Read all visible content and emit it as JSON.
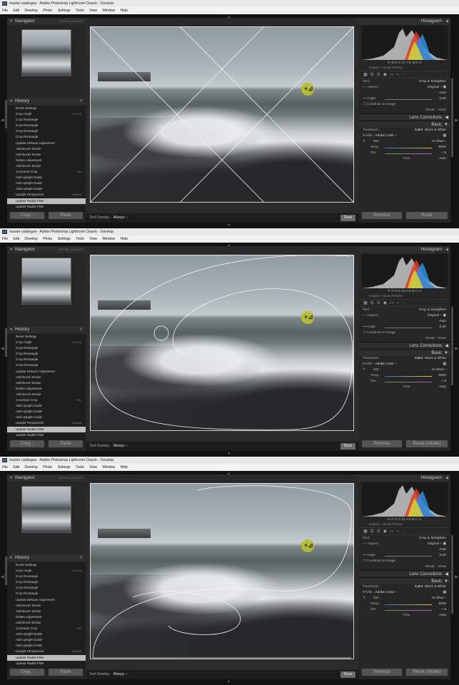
{
  "window": {
    "logo": "Lr",
    "title": "master catalogue - Adobe Photoshop Lightroom Classic - Develop"
  },
  "menu": [
    "File",
    "Edit",
    "Develop",
    "Photo",
    "Settings",
    "Tools",
    "View",
    "Window",
    "Help"
  ],
  "navigator": {
    "title": "Navigator",
    "zoom_options": "FIT FILL 1:1 1:2 ⇕"
  },
  "history": {
    "title": "History",
    "items": [
      {
        "label": "Reset Settings",
        "value": ""
      },
      {
        "label": "Crop Angle",
        "value": "-0,0  0,0"
      },
      {
        "label": "Crop Rectangle",
        "value": ""
      },
      {
        "label": "Crop Rectangle",
        "value": ""
      },
      {
        "label": "Crop Rectangle",
        "value": ""
      },
      {
        "label": "Crop Rectangle",
        "value": ""
      },
      {
        "label": "Update Dehaze Adjustment",
        "value": ""
      },
      {
        "label": "Add Brush Stroke",
        "value": ""
      },
      {
        "label": "Add Brush Stroke",
        "value": ""
      },
      {
        "label": "Delete Adjustment",
        "value": ""
      },
      {
        "label": "Add Brush Stroke",
        "value": ""
      },
      {
        "label": "Constrain Crop",
        "value": "Yes"
      },
      {
        "label": "Add Upright Guide",
        "value": ""
      },
      {
        "label": "Add Upright Guide",
        "value": ""
      },
      {
        "label": "Add Upright Guide",
        "value": ""
      },
      {
        "label": "Upright Perspective",
        "value": "Guided"
      },
      {
        "label": "Update Radial Filter",
        "value": ""
      },
      {
        "label": "Update Radial Filter",
        "value": ""
      }
    ],
    "selected_index": 16
  },
  "left_buttons": {
    "copy": "Copy...",
    "paste": "Paste"
  },
  "toolbar": {
    "label": "Tool Overlay :",
    "value": "Always",
    "done": "Done"
  },
  "right": {
    "histogram_title": "Histogram",
    "smart_preview": "Original + Smart Preview",
    "crop": {
      "tool": "Tool :",
      "tool_value": "Crop & Straighten",
      "aspect": "Aspect :",
      "aspect_value": "Original ÷",
      "auto": "Auto",
      "angle": "Angle",
      "angle_value": "0,00",
      "constrain": "Constrain to Image",
      "reset": "Reset",
      "close": "Close"
    },
    "lens_corrections": "Lens Corrections",
    "basic": {
      "title": "Basic",
      "treatment": "Treatment :",
      "color": "Color",
      "bw": "Black & White",
      "profile": "Profile :",
      "profile_value": "Adobe Color ÷",
      "wb": "WB :",
      "wb_value": "As Shot ÷",
      "temp": "Temp",
      "temp_value": "5000",
      "tint": "Tint",
      "tint_value": "+ 6",
      "tone": "Tone",
      "tone_auto": "Auto"
    }
  },
  "screens": [
    {
      "overlay": "diagonal-thirds",
      "rgb": "R  46,6  G  47,7  B  49,0  %",
      "bottom_right": "Reset",
      "previous": "Previous"
    },
    {
      "overlay": "golden-spiral",
      "rgb": "R  47,8  G  51,4  B  53,1  %",
      "bottom_right": "Reset (Adobe)",
      "previous": "Previous"
    },
    {
      "overlay": "golden-spiral-rotated",
      "rgb": "R  47,8  G  51,4  B  53,1  %",
      "bottom_right": "Reset (Adobe)",
      "previous": "Previous"
    }
  ],
  "icons": [
    "chevron-up-icon",
    "chevron-down-icon",
    "chevron-left-icon",
    "chevron-right-icon",
    "eyedropper-icon",
    "close-icon",
    "lock-icon"
  ]
}
